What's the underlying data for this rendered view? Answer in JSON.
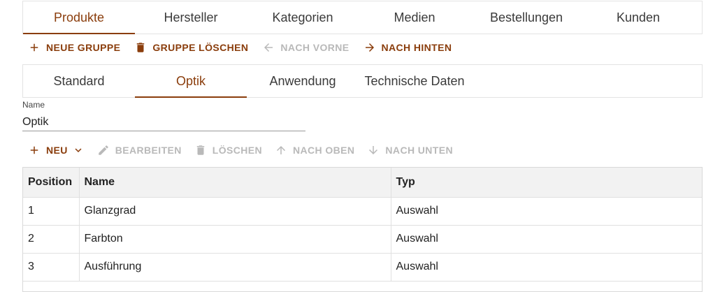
{
  "main_tabs": [
    {
      "label": "Produkte",
      "active": true
    },
    {
      "label": "Hersteller",
      "active": false
    },
    {
      "label": "Kategorien",
      "active": false
    },
    {
      "label": "Medien",
      "active": false
    },
    {
      "label": "Bestellungen",
      "active": false
    },
    {
      "label": "Kunden",
      "active": false
    }
  ],
  "group_toolbar": {
    "new_group": "Neue Gruppe",
    "delete_group": "Gruppe löschen",
    "move_forward": "Nach vorne",
    "move_back": "Nach hinten"
  },
  "sub_tabs": [
    {
      "label": "Standard",
      "active": false
    },
    {
      "label": "Optik",
      "active": true
    },
    {
      "label": "Anwendung",
      "active": false
    },
    {
      "label": "Technische Daten",
      "active": false
    }
  ],
  "name_field": {
    "label": "Name",
    "value": "Optik"
  },
  "attr_toolbar": {
    "new": "Neu",
    "edit": "Bearbeiten",
    "delete": "Löschen",
    "move_up": "Nach oben",
    "move_down": "Nach unten"
  },
  "table": {
    "columns": [
      "Position",
      "Name",
      "Typ"
    ],
    "rows": [
      [
        "1",
        "Glanzgrad",
        "Auswahl"
      ],
      [
        "2",
        "Farbton",
        "Auswahl"
      ],
      [
        "3",
        "Ausführung",
        "Auswahl"
      ]
    ]
  },
  "colors": {
    "accent": "#8a3d0c",
    "disabled": "#b9b9b9"
  }
}
